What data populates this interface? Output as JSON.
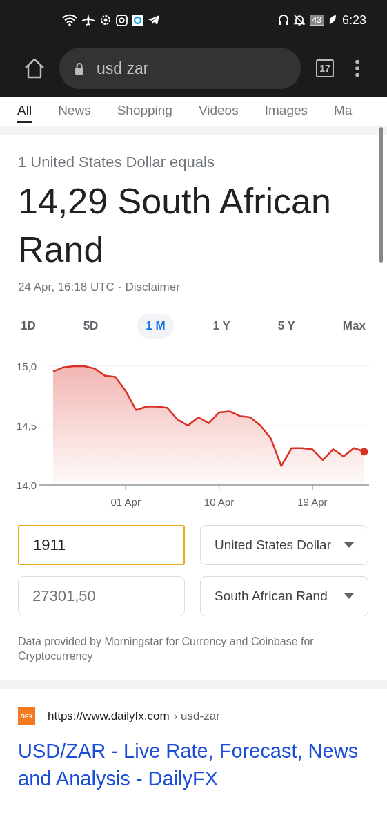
{
  "status_bar": {
    "battery": "43",
    "time": "6:23"
  },
  "address_bar": {
    "query": "usd zar",
    "tab_count": "17"
  },
  "search_tabs": [
    {
      "label": "All",
      "selected": true
    },
    {
      "label": "News",
      "selected": false
    },
    {
      "label": "Shopping",
      "selected": false
    },
    {
      "label": "Videos",
      "selected": false
    },
    {
      "label": "Images",
      "selected": false
    },
    {
      "label": "Ma",
      "selected": false
    }
  ],
  "currency_card": {
    "subtitle": "1 United States Dollar equals",
    "result": "14,29 South African Rand",
    "timestamp": "24 Apr, 16:18 UTC",
    "separator": "·",
    "disclaimer": "Disclaimer",
    "ranges": [
      {
        "label": "1D",
        "selected": false
      },
      {
        "label": "5D",
        "selected": false
      },
      {
        "label": "1 M",
        "selected": true
      },
      {
        "label": "1 Y",
        "selected": false
      },
      {
        "label": "5 Y",
        "selected": false
      },
      {
        "label": "Max",
        "selected": false
      }
    ],
    "chart_data": {
      "type": "area",
      "categories": [
        null,
        null,
        null,
        null,
        null,
        null,
        null,
        "01 Apr",
        null,
        null,
        null,
        null,
        null,
        null,
        null,
        null,
        "10 Apr",
        null,
        null,
        null,
        null,
        null,
        null,
        null,
        null,
        "19 Apr",
        null,
        null,
        null,
        null,
        null
      ],
      "series": [
        {
          "color": "#d93025",
          "values": [
            14.955,
            14.99,
            15.0,
            15.0,
            14.98,
            14.92,
            14.91,
            14.79,
            14.63,
            14.66,
            14.66,
            14.65,
            14.55,
            14.5,
            14.57,
            14.52,
            14.61,
            14.62,
            14.58,
            14.57,
            14.5,
            14.39,
            14.16,
            14.31,
            14.31,
            14.3,
            14.21,
            14.3,
            14.24,
            14.31,
            14.28
          ]
        }
      ],
      "ylim": [
        14.0,
        15.0
      ],
      "yticks": [
        {
          "value": 14.0,
          "label": "14,0"
        },
        {
          "value": 14.5,
          "label": "14,5"
        },
        {
          "value": 15.0,
          "label": "15,0"
        }
      ]
    },
    "amount_from": {
      "value": "1911",
      "focused": true
    },
    "currency_from": "United States Dollar",
    "amount_to": {
      "value": "27301,50",
      "focused": false
    },
    "currency_to": "South African Rand",
    "source_note": "Data provided by Morningstar for Currency and Coinbase for Cryptocurrency"
  },
  "result": {
    "favicon": "DFX",
    "url": "https://www.dailyfx.com",
    "path": "› usd-zar",
    "title": "USD/ZAR - Live Rate, Forecast, News and Analysis - DailyFX"
  }
}
